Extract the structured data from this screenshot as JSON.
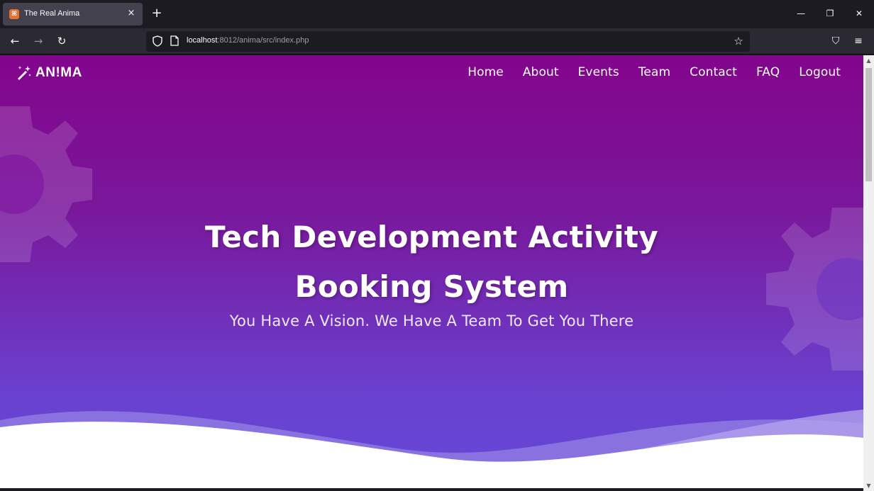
{
  "browser": {
    "tab": {
      "title": "The Real Anima",
      "close_glyph": "×",
      "favicon": "xampp-icon"
    },
    "new_tab_glyph": "+",
    "window_controls": {
      "minimize": "—",
      "restore": "❐",
      "close": "✕"
    },
    "nav": {
      "back": "←",
      "forward": "→",
      "reload": "↻"
    },
    "url": {
      "host": "localhost",
      "rest": ":8012/anima/src/index.php"
    },
    "bookmark_glyph": "☆",
    "pocket_glyph": "⛉",
    "menu_glyph": "≡"
  },
  "site": {
    "brand": "AN!MA",
    "brand_icon": "magic-wand-icon",
    "menu": [
      {
        "label": "Home"
      },
      {
        "label": "About"
      },
      {
        "label": "Events"
      },
      {
        "label": "Team"
      },
      {
        "label": "Contact"
      },
      {
        "label": "FAQ"
      },
      {
        "label": "Logout"
      }
    ],
    "hero": {
      "title_line1": "Tech Development Activity",
      "title_line2": "Booking System",
      "subtitle": "You Have A Vision. We Have A Team To Get You There"
    }
  },
  "colors": {
    "gradient_top": "#83058c",
    "gradient_bottom": "#6349d9",
    "wave_light": "#9c8be6",
    "wave_white": "#ffffff"
  },
  "scrollbar": {
    "up": "▲",
    "down": "▼"
  }
}
